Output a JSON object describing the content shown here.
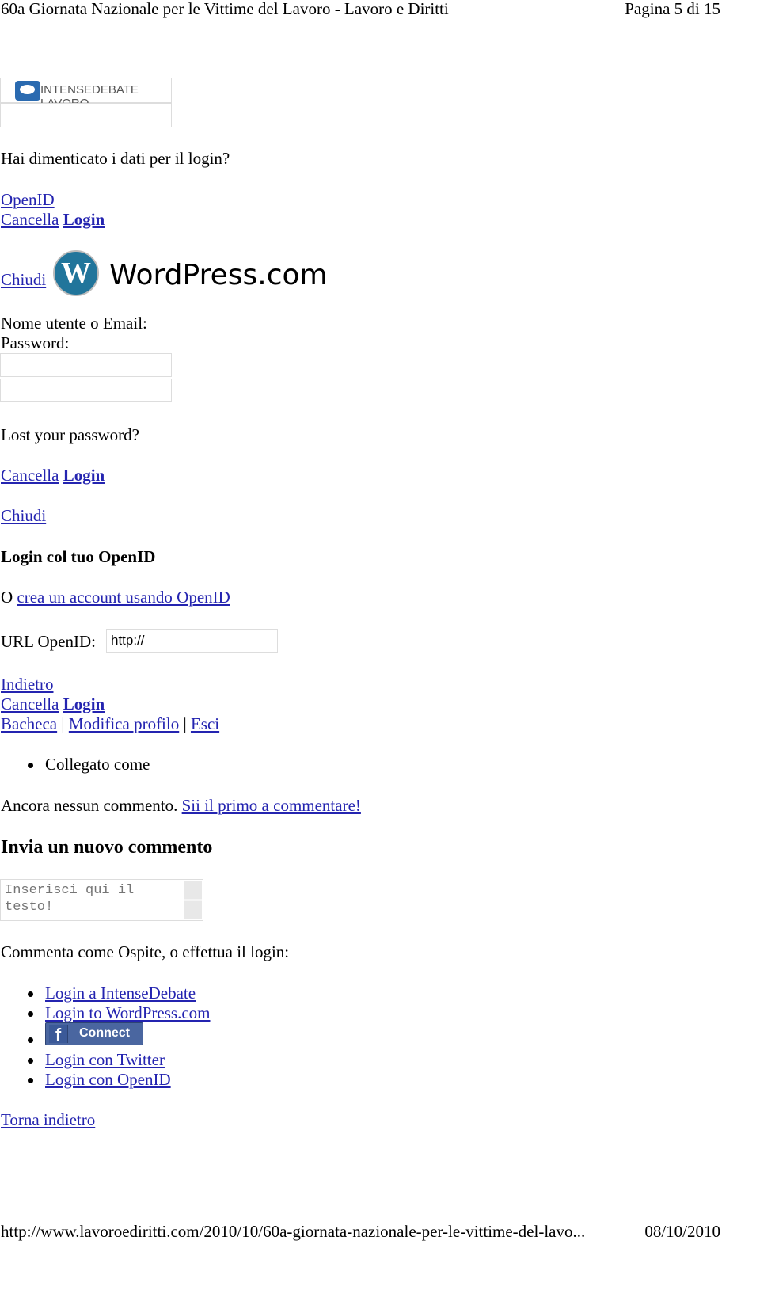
{
  "header": {
    "title": "60a Giornata Nazionale per le Vittime del Lavoro - Lavoro e Diritti",
    "page": "Pagina 5 di 15"
  },
  "intensedebate_box": {
    "logo_text": "INTENSEDEBATE LAVORO"
  },
  "forgot": "Hai dimenticato i dati per il login?",
  "openid_link": "OpenID",
  "cancel": "Cancella",
  "login": "Login",
  "close": "Chiudi",
  "wordpress": {
    "logo_text": "WordPress.com",
    "username_label": "Nome utente o Email:",
    "password_label": "Password:",
    "lost_password": "Lost your password?"
  },
  "openid": {
    "title": "Login col tuo OpenID",
    "or": "O",
    "create_link": "crea un account usando OpenID",
    "url_label": "URL OpenID:",
    "url_value": "http://",
    "back": "Indietro"
  },
  "user_links": [
    "Bacheca",
    "Modifica profilo",
    "Esci"
  ],
  "logged_as": "Collegato come",
  "no_comments": "Ancora nessun commento.",
  "first_comment": "Sii il primo a commentare!",
  "new_comment": {
    "title": "Invia un nuovo commento",
    "placeholder": "Inserisci qui il testo!"
  },
  "comment_as": "Commenta come Ospite, o effettua il login:",
  "login_options": [
    "Login a IntenseDebate",
    "Login to WordPress.com",
    "Connect",
    "Login con Twitter",
    "Login con OpenID"
  ],
  "back_link": "Torna indietro",
  "footer": {
    "url": "http://www.lavoroediritti.com/2010/10/60a-giornata-nazionale-per-le-vittime-del-lavo...",
    "date": "08/10/2010"
  },
  "colors": {
    "link": "#2424b0",
    "facebook": "#3b5998"
  }
}
